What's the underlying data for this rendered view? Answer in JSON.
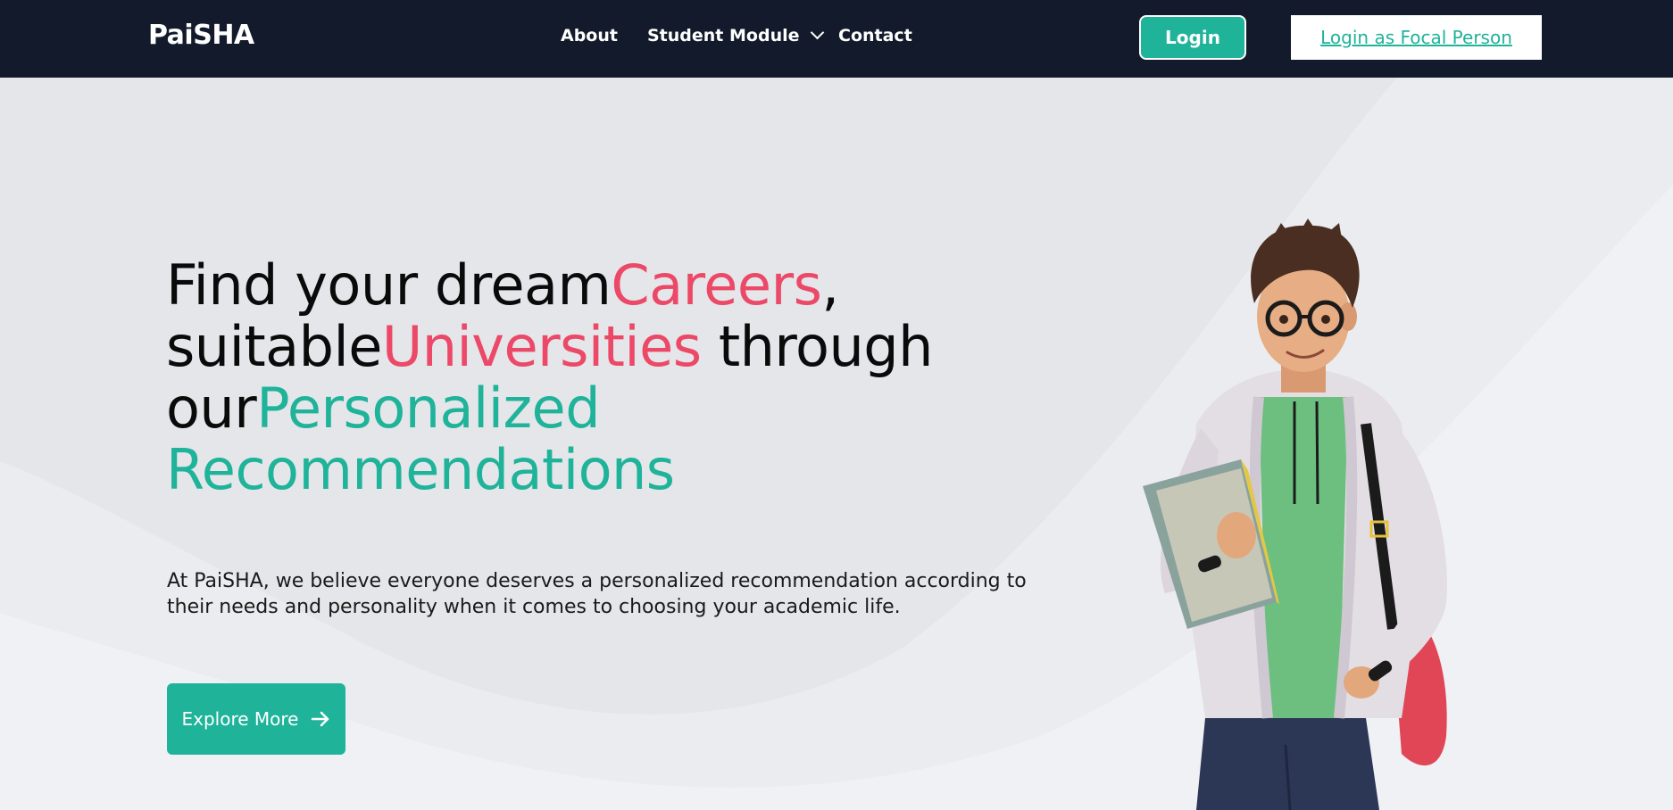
{
  "navbar": {
    "brand": "PaiSHA",
    "links": [
      {
        "label": "About"
      },
      {
        "label": "Student Module"
      },
      {
        "label": "Contact"
      }
    ],
    "login_label": "Login",
    "focal_login_label": "Login as Focal Person"
  },
  "hero": {
    "headline": {
      "part1": "Find your dream",
      "careers": "Careers",
      "comma": ",",
      "part2": "suitable",
      "universities": "Universities",
      "part3": " through",
      "part4": "our",
      "personalized": "Personalized",
      "recommendations": "Recommendations"
    },
    "tagline": "At PaiSHA, we believe everyone deserves a personalized recommendation according to their needs and personality when it comes to choosing your academic life.",
    "cta_label": "Explore More"
  },
  "icons": {
    "student_module_dropdown": "chevron-down-icon",
    "explore_more": "arrow-right-icon",
    "hero_image": "student-illustration"
  },
  "colors": {
    "navbar_bg": "#121a2b",
    "accent_teal": "#1fb39a",
    "accent_pink": "#ec4867",
    "hero_bg": "#e6e7eb"
  }
}
